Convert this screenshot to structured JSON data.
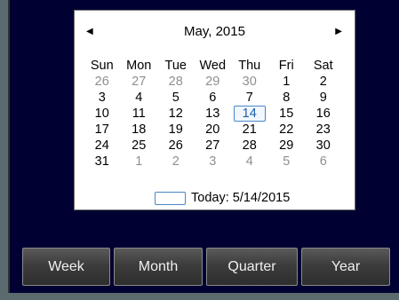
{
  "calendar": {
    "title": "May, 2015",
    "prev_glyph": "◀",
    "next_glyph": "▶",
    "days_of_week": [
      "Sun",
      "Mon",
      "Tue",
      "Wed",
      "Thu",
      "Fri",
      "Sat"
    ],
    "weeks": [
      [
        "26",
        "27",
        "28",
        "29",
        "30",
        "1",
        "2"
      ],
      [
        "3",
        "4",
        "5",
        "6",
        "7",
        "8",
        "9"
      ],
      [
        "10",
        "11",
        "12",
        "13",
        "14",
        "15",
        "16"
      ],
      [
        "17",
        "18",
        "19",
        "20",
        "21",
        "22",
        "23"
      ],
      [
        "24",
        "25",
        "26",
        "27",
        "28",
        "29",
        "30"
      ],
      [
        "31",
        "1",
        "2",
        "3",
        "4",
        "5",
        "6"
      ]
    ],
    "selected_day": "14",
    "today_label": "Today: 5/14/2015"
  },
  "range_buttons": {
    "week": "Week",
    "month": "Month",
    "quarter": "Quarter",
    "year": "Year"
  },
  "colors": {
    "background": "#000033",
    "today_border": "#4a86c8",
    "other_month_text": "#8f8f8f"
  }
}
